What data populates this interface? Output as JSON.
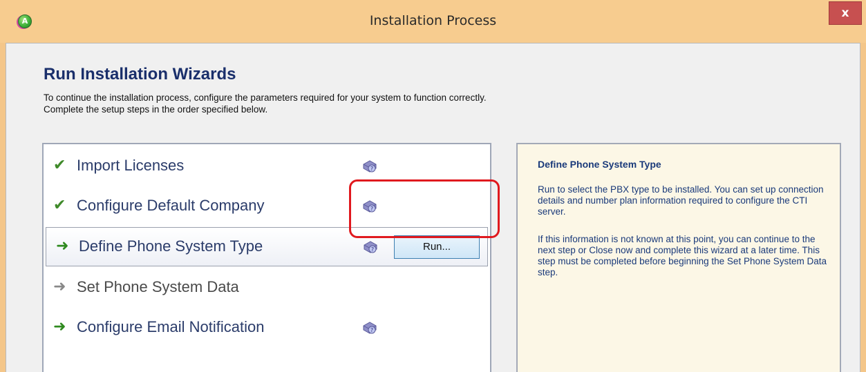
{
  "window": {
    "title": "Installation Process",
    "app_icon_letter": "A",
    "close_label": "x"
  },
  "header": {
    "heading": "Run Installation Wizards",
    "description": "To continue the installation process, configure the parameters required for your system to function correctly.  Complete the setup steps in the order specified below."
  },
  "steps": [
    {
      "label": "Import Licenses",
      "status": "completed",
      "icon": "check-icon",
      "has_help": true
    },
    {
      "label": "Configure Default Company",
      "status": "completed",
      "icon": "check-icon",
      "has_help": true
    },
    {
      "label": "Define Phone System Type",
      "status": "current",
      "icon": "arrow-right-icon",
      "has_help": true,
      "run_label": "Run..."
    },
    {
      "label": "Set Phone System Data",
      "status": "disabled",
      "icon": "arrow-right-icon",
      "has_help": false
    },
    {
      "label": "Configure Email Notification",
      "status": "pending",
      "icon": "arrow-right-icon",
      "has_help": true
    }
  ],
  "info": {
    "title": "Define Phone System Type",
    "paragraph1": "Run to select the PBX type to be installed. You can set up connection details and number plan information required to configure the CTI server.",
    "paragraph2": "If this information is not known at this point, you can continue to the next step or Close now and complete this wizard at a later time. This step must be completed before beginning the Set Phone System Data step."
  },
  "colors": {
    "title_bar": "#f7cc8f",
    "close_button": "#c75050",
    "heading": "#1a2f6b",
    "highlight": "#e0191e",
    "info_background": "#fcf7e6"
  }
}
